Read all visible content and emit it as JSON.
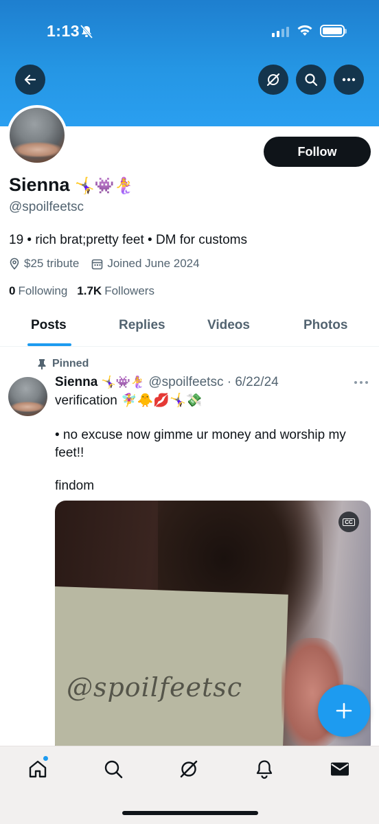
{
  "status_bar": {
    "time": "1:13"
  },
  "profile": {
    "follow_label": "Follow",
    "name": "Sienna",
    "name_emoji": "🤸‍♀️👾🧜‍♀️",
    "handle": "@spoilfeetsc",
    "bio": "19 • rich brat;pretty feet • DM for customs",
    "location": "$25 tribute",
    "joined": "Joined June 2024",
    "following_count": "0",
    "following_label": "Following",
    "followers_count": "1.7K",
    "followers_label": "Followers"
  },
  "tabs": [
    {
      "label": "Posts"
    },
    {
      "label": "Replies"
    },
    {
      "label": "Videos"
    },
    {
      "label": "Photos"
    }
  ],
  "post": {
    "pinned_label": "Pinned",
    "author_name": "Sienna",
    "author_emoji": "🤸‍♀️👾🧜‍♀️",
    "author_meta": "@spoilfeetsc · 6/22/24",
    "line1": "verification 🧚‍♀️🐥💋🤸‍♀️💸",
    "line2": "• no excuse now gimme ur money and worship my",
    "line3": "feet!!",
    "line4": "findom",
    "media_sign_text": "@spoilfeetsc",
    "cc_label": "CC"
  },
  "icons": {
    "back": "arrow-left-icon",
    "grok": "grok-icon",
    "search": "search-icon",
    "more": "more-icon",
    "location": "location-pin-icon",
    "calendar": "calendar-icon",
    "pin": "pin-icon",
    "compose": "plus-icon",
    "nav": [
      "home-icon",
      "search-icon",
      "grok-icon",
      "bell-icon",
      "mail-icon"
    ]
  },
  "colors": {
    "accent": "#1d9bf0",
    "text": "#0f1419",
    "muted": "#536471"
  }
}
